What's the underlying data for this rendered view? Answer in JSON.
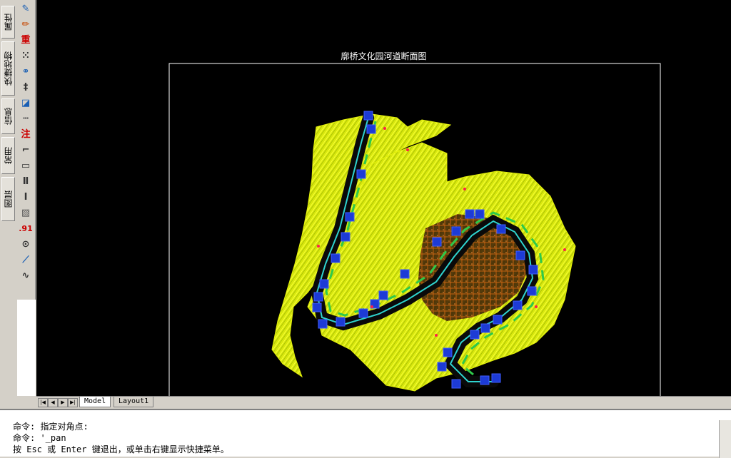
{
  "sidebar_tabs": [
    {
      "label": "属性",
      "icon": "properties-icon"
    },
    {
      "label": "快捷地物",
      "icon": "quick-feature-icon"
    },
    {
      "label": "信息",
      "icon": "info-icon"
    },
    {
      "label": "常用",
      "icon": "common-icon"
    },
    {
      "label": "图层",
      "icon": "layer-icon"
    }
  ],
  "toolbar": {
    "tools": [
      {
        "name": "pencil-tool-icon",
        "glyph": "✎",
        "color": "#1a5fb4"
      },
      {
        "name": "color-pencil-tool-icon",
        "glyph": "✏",
        "color": "#c64600"
      },
      {
        "name": "redraw-tool-icon",
        "glyph": "重",
        "color": "#cc0000"
      },
      {
        "name": "node-edit-tool-icon",
        "glyph": "⁙",
        "color": "#333333"
      },
      {
        "name": "link-tool-icon",
        "glyph": "⚭",
        "color": "#1a5fb4"
      },
      {
        "name": "coordinate-tool-icon",
        "glyph": "‡",
        "color": "#333333"
      },
      {
        "name": "area-tool-icon",
        "glyph": "◪",
        "color": "#1a5fb4"
      },
      {
        "name": "measure-tool-icon",
        "glyph": "┅",
        "color": "#555555"
      },
      {
        "name": "annotate-tool-icon",
        "glyph": "注",
        "color": "#cc0000"
      },
      {
        "name": "polygon-tool-icon",
        "glyph": "⌐",
        "color": "#333333"
      },
      {
        "name": "rectangle-tool-icon",
        "glyph": "▭",
        "color": "#333333"
      },
      {
        "name": "parallel-tool-icon",
        "glyph": "Ⅱ",
        "color": "#333333"
      },
      {
        "name": "dimension-tool-icon",
        "glyph": "Ⅰ",
        "color": "#333333"
      },
      {
        "name": "hatch-tool-icon",
        "glyph": "▨",
        "color": "#555555"
      },
      {
        "name": "number-tool-icon",
        "glyph": ".91",
        "color": "#cc0000"
      },
      {
        "name": "circle-tool-icon",
        "glyph": "⊙",
        "color": "#333333"
      },
      {
        "name": "line-tool-icon",
        "glyph": "⟋",
        "color": "#1a5fb4"
      },
      {
        "name": "curve-tool-icon",
        "glyph": "∿",
        "color": "#333333"
      }
    ]
  },
  "canvas": {
    "drawing_title": "廓桥文化园河道断面图",
    "background_color": "#000000",
    "terrain_color": "#e6f20f",
    "river_color": "#1d3bd6"
  },
  "layout_tabs": [
    "Model",
    "Layout1"
  ],
  "command_lines": [
    "命令: 指定对角点:",
    "命令: '_pan",
    "按 Esc 或 Enter 键退出，或单击右键显示快捷菜单。"
  ]
}
